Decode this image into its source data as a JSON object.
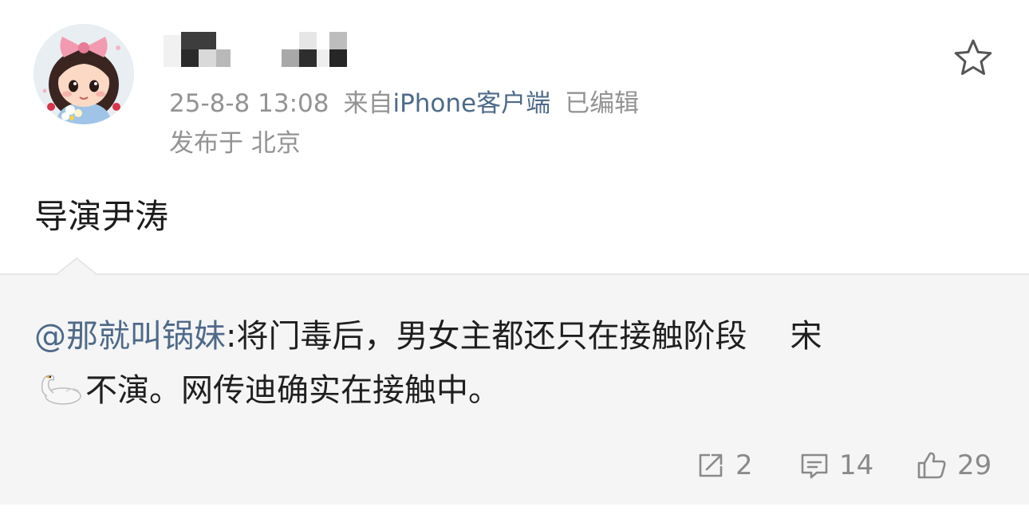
{
  "post": {
    "meta": {
      "time": "25-8-8 13:08",
      "source_prefix": "来自",
      "client": "iPhone客户端",
      "edited": "已编辑"
    },
    "location": "发布于 北京",
    "text": "导演尹涛"
  },
  "repost": {
    "mention": "@那就叫锅妹",
    "text_part1": ":将门毒后，男女主都还只在接触阶段",
    "text_part2": "宋",
    "text_part3": "不演。网传迪确实在接触中。"
  },
  "actions": {
    "share_count": "2",
    "comment_count": "14",
    "like_count": "29"
  },
  "icons": {
    "favorite": "star-outline-icon",
    "share": "share-icon",
    "comment": "comment-icon",
    "like": "thumbs-up-icon",
    "emoji": "swan-emoji"
  },
  "colors": {
    "link": "#4e6a8a",
    "meta_gray": "#939393",
    "repost_bg": "#f5f5f5"
  }
}
